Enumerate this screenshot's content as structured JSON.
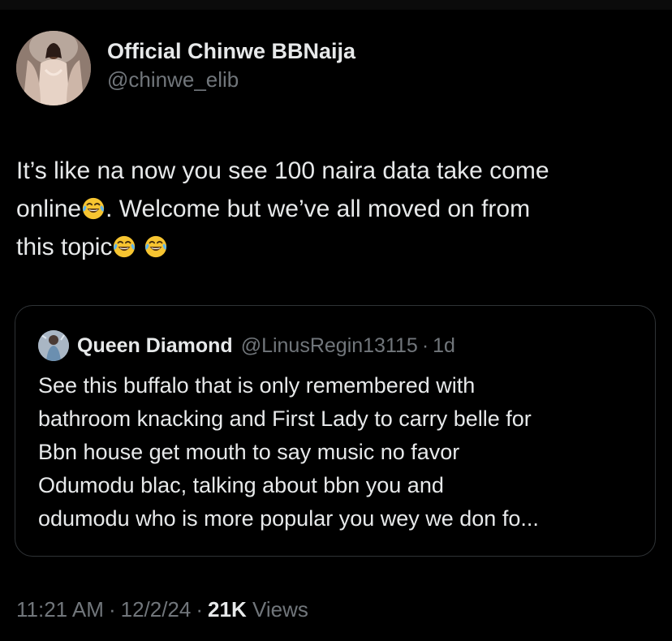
{
  "author": {
    "display_name": "Official Chinwe BBNaija",
    "handle": "@chinwe_elib"
  },
  "tweet": {
    "text_line1": "It’s like na now you see 100 naira data take come",
    "text_line2_a": "online",
    "text_line2_b": ". Welcome but we’ve all moved on from",
    "text_line3": "this topic",
    "emoji_name": "face-with-tears-of-joy-icon"
  },
  "quoted_tweet": {
    "display_name": "Queen Diamond",
    "handle": "@LinusRegin13115",
    "separator": "·",
    "time": "1d",
    "lines": [
      "See this buffalo that is only remembered with",
      "bathroom knacking and First Lady to carry belle for",
      "Bbn house get mouth to say music no favor",
      "Odumodu blac, talking about bbn you and",
      "odumodu who is more popular you wey we don fo..."
    ]
  },
  "meta": {
    "time": "11:21 AM",
    "separator": "·",
    "date": "12/2/24",
    "views_count": "21K",
    "views_label": "Views"
  },
  "colors": {
    "background": "#000000",
    "primary_text": "#e7e9ea",
    "secondary_text": "#71767b",
    "border": "#2f3336",
    "emoji_face": "#f7c531",
    "emoji_tears": "#5ab4f0"
  }
}
